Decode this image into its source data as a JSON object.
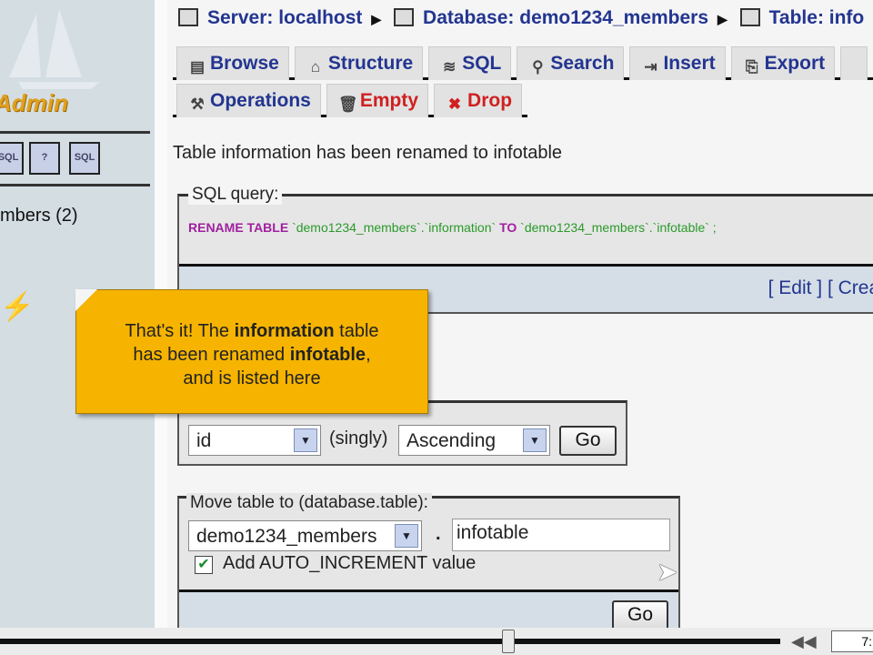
{
  "sidebar": {
    "logo_text": "Admin",
    "db_item": "mbers (2)",
    "icons": [
      "sql-window-icon",
      "help-icon",
      "sql-docs-icon"
    ],
    "icon_labels": [
      "SQL",
      "?",
      "SQL"
    ]
  },
  "breadcrumb": {
    "server": "Server: localhost",
    "database": "Database: demo1234_members",
    "table": "Table: info"
  },
  "tabs_row1": [
    {
      "label": "Browse",
      "icon": "▤"
    },
    {
      "label": "Structure",
      "icon": "⌂"
    },
    {
      "label": "SQL",
      "icon": "≋"
    },
    {
      "label": "Search",
      "icon": "⚲"
    },
    {
      "label": "Insert",
      "icon": "⇥"
    },
    {
      "label": "Export",
      "icon": "⎘"
    }
  ],
  "tabs_row2": [
    {
      "label": "Operations",
      "icon": "⚒"
    },
    {
      "label": "Empty",
      "icon": "🗑"
    },
    {
      "label": "Drop",
      "icon": "✖"
    }
  ],
  "message": "Table information has been renamed to infotable",
  "sql_box": {
    "legend": "SQL query:",
    "kw1": "RENAME TABLE",
    "s1": " `demo1234_members`.`information` ",
    "kw2": "TO",
    "s2": " `demo1234_members`.`infotable` ;",
    "edit": "[ Edit ]",
    "create": " [ Creat"
  },
  "callout": {
    "t1": "That's it! The ",
    "b1": "information",
    "t2": " table",
    "t3": "has been renamed ",
    "b2": "infotable",
    "t4": ",",
    "t5": "and is listed here"
  },
  "order_box": {
    "column": "id",
    "singly": "(singly)",
    "direction": "Ascending",
    "go": "Go"
  },
  "move_box": {
    "legend": "Move table to (database.table):",
    "database": "demo1234_members",
    "dot": ".",
    "table": "infotable",
    "auto_inc_label": "Add AUTO_INCREMENT value",
    "auto_inc_checked": true,
    "go": "Go"
  },
  "player": {
    "time": "7:",
    "progress_percent": 65,
    "rewind": "◀◀"
  }
}
